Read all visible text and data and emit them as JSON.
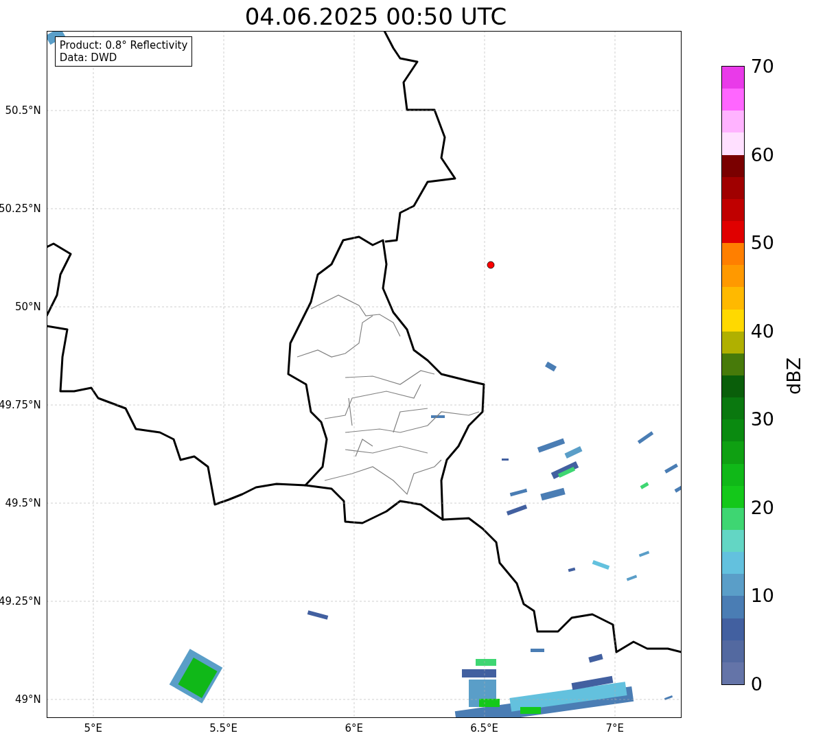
{
  "title": "04.06.2025 00:50 UTC",
  "info_box": {
    "lines": [
      "Product: 0.8° Reflectivity",
      "Data: DWD"
    ]
  },
  "map": {
    "xticks": [
      "5°E",
      "5.5°E",
      "6°E",
      "6.5°E",
      "7°E"
    ],
    "yticks": [
      "50.5°N",
      "50.25°N",
      "50°N",
      "49.75°N",
      "49.5°N",
      "49.25°N",
      "49°N"
    ]
  },
  "colorbar": {
    "label": "dBZ",
    "ticks": [
      "70",
      "60",
      "50",
      "40",
      "30",
      "20",
      "10",
      "0"
    ],
    "bands": [
      {
        "color": "#e93ae9"
      },
      {
        "color": "#ff66ff"
      },
      {
        "color": "#ffb3ff"
      },
      {
        "color": "#ffe0ff"
      },
      {
        "color": "#7a0000"
      },
      {
        "color": "#a00000"
      },
      {
        "color": "#c00000"
      },
      {
        "color": "#e00000"
      },
      {
        "color": "#ff7f00"
      },
      {
        "color": "#ff9900"
      },
      {
        "color": "#ffb900"
      },
      {
        "color": "#ffd900"
      },
      {
        "color": "#b0b000"
      },
      {
        "color": "#477a0a"
      },
      {
        "color": "#0a5e0a"
      },
      {
        "color": "#0a780f"
      },
      {
        "color": "#0a8a10"
      },
      {
        "color": "#0fa012"
      },
      {
        "color": "#10b818"
      },
      {
        "color": "#14c81a"
      },
      {
        "color": "#3ed672"
      },
      {
        "color": "#63d6c4"
      },
      {
        "color": "#63c1de"
      },
      {
        "color": "#5a9ec8"
      },
      {
        "color": "#4a7db4"
      },
      {
        "color": "#4260a0"
      },
      {
        "color": "#5369a0"
      },
      {
        "color": "#6474a8"
      }
    ]
  }
}
